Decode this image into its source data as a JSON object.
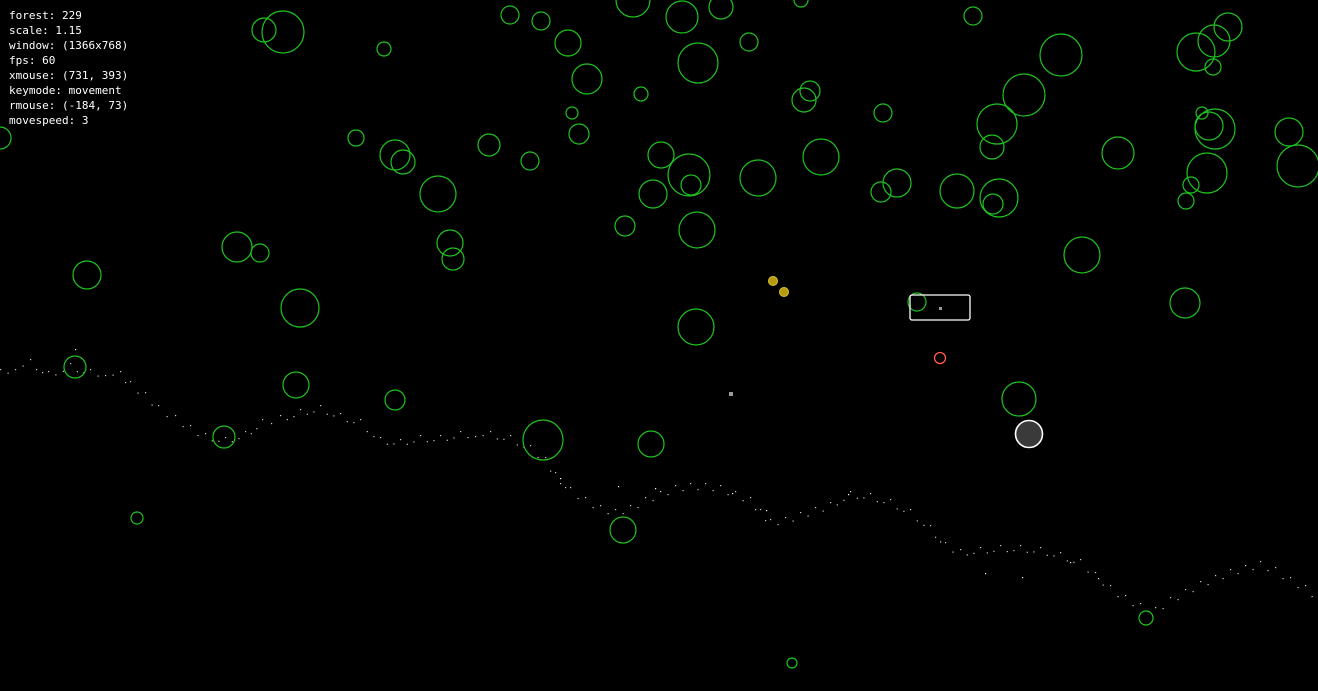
{
  "debug": [
    {
      "key": "forest",
      "value": "229"
    },
    {
      "key": "scale",
      "value": "1.15"
    },
    {
      "key": "window",
      "value": "(1366x768)"
    },
    {
      "key": "fps",
      "value": "60"
    },
    {
      "key": "xmouse",
      "value": "(731, 393)"
    },
    {
      "key": "keymode",
      "value": "movement"
    },
    {
      "key": "rmouse",
      "value": "(-184, 73)"
    },
    {
      "key": "movespeed",
      "value": "3"
    }
  ],
  "colors": {
    "background": "#000000",
    "tree_stroke": "#1fc41f",
    "path_dot": "#ffffff",
    "item_fill": "#b59a14",
    "item_stroke": "#e0c030",
    "player_fill": "#3a3a3a",
    "player_stroke": "#ffffff",
    "target_stroke": "#ff5a4a",
    "cursor": "#9a9a9a",
    "text": "#ffffff"
  }
}
